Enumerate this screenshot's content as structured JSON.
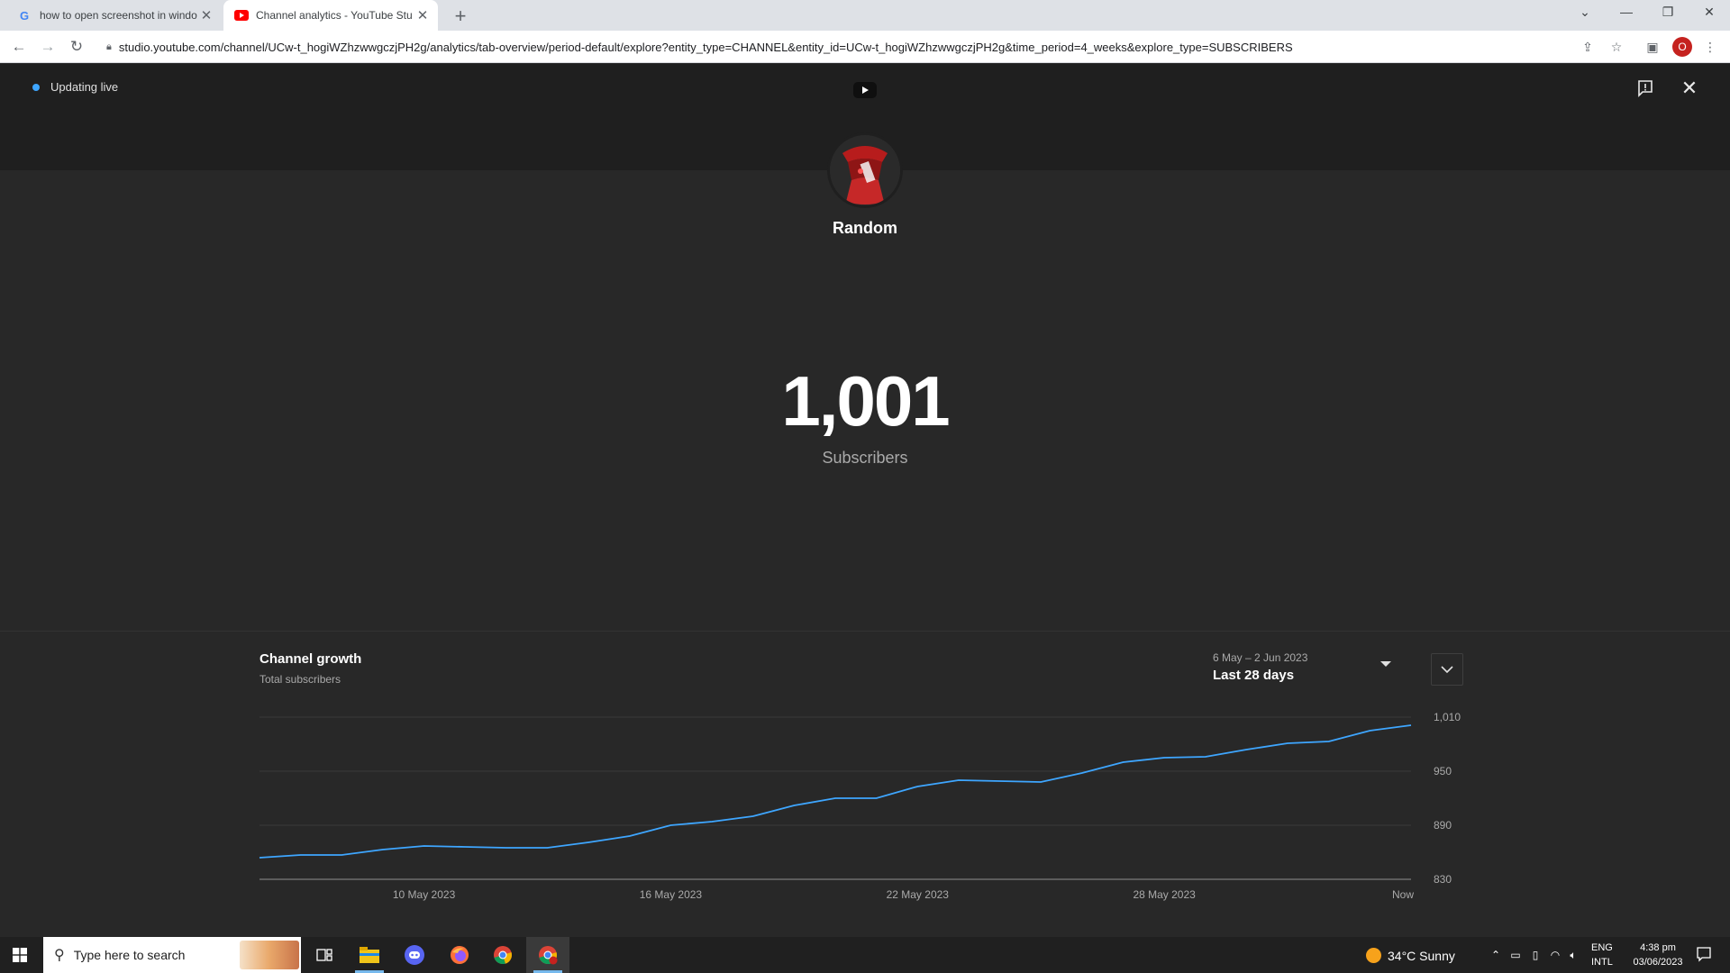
{
  "browser": {
    "tabs": [
      {
        "title": "how to open screenshot in windo",
        "favicon": "google-icon",
        "active": false
      },
      {
        "title": "Channel analytics - YouTube Stu",
        "favicon": "youtube-icon",
        "active": true
      }
    ],
    "url": "studio.youtube.com/channel/UCw-t_hogiWZhzwwgczjPH2g/analytics/tab-overview/period-default/explore?entity_type=CHANNEL&entity_id=UCw-t_hogiWZhzwwgczjPH2g&time_period=4_weeks&explore_type=SUBSCRIBERS",
    "profile_initial": "O"
  },
  "live": {
    "status": "Updating live",
    "channel_name": "Random",
    "subscriber_count": "1,001",
    "subscriber_label": "Subscribers"
  },
  "growth": {
    "title": "Channel growth",
    "subtitle": "Total subscribers",
    "period_range": "6 May – 2 Jun 2023",
    "period_label": "Last 28 days"
  },
  "chart_data": {
    "type": "line",
    "title": "Channel growth",
    "ylabel": "Total subscribers",
    "ylim": [
      830,
      1010
    ],
    "y_ticks": [
      "830",
      "890",
      "950",
      "1,010"
    ],
    "x_tick_labels": [
      "10 May 2023",
      "16 May 2023",
      "22 May 2023",
      "28 May 2023",
      "Now"
    ],
    "line_color": "#3ea6ff",
    "series": [
      {
        "values": [
          854,
          857,
          857,
          863,
          867,
          866,
          865,
          865,
          871,
          878,
          890,
          894,
          900,
          912,
          920,
          920,
          933,
          940,
          939,
          938,
          948,
          960,
          965,
          966,
          974,
          981,
          983,
          995,
          1001
        ]
      }
    ]
  },
  "taskbar": {
    "search_placeholder": "Type here to search",
    "weather": "34°C  Sunny",
    "lang_line1": "ENG",
    "lang_line2": "INTL",
    "time": "4:38 pm",
    "date": "03/06/2023"
  }
}
